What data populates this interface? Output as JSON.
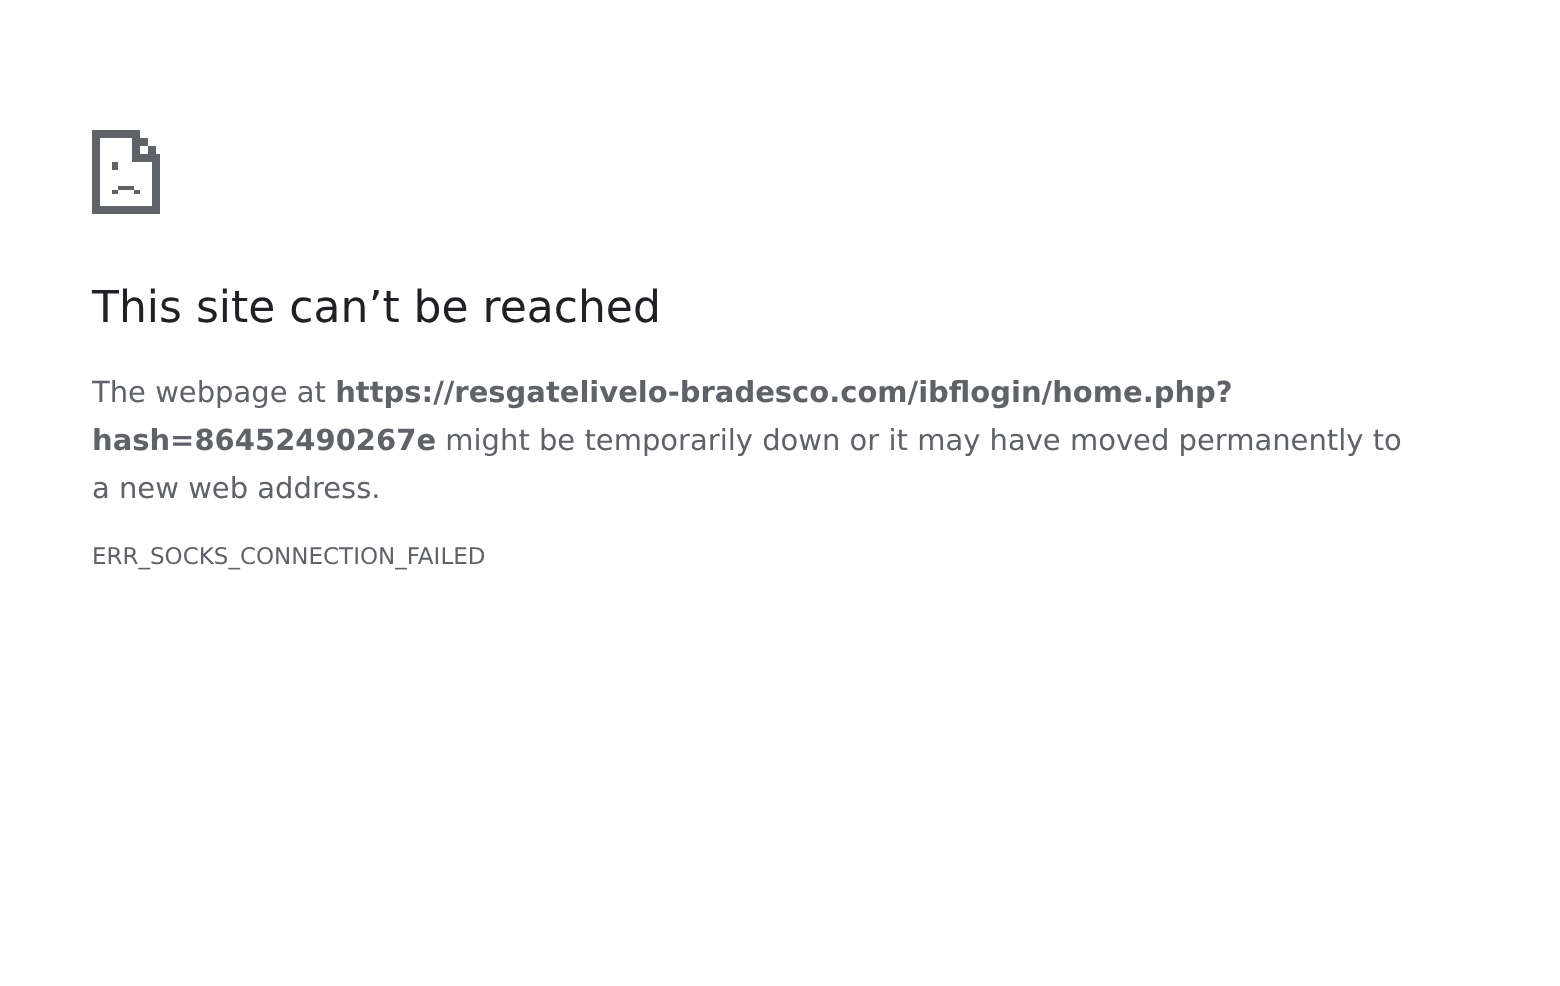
{
  "heading": "This site can’t be reached",
  "description": "The webpage at **https://resgatelivelo-bradesco.com/ibflogin/home.php?hash=86452490267e** might be temporarily down or it may have moved permanently to a new web address.",
  "error_code": "ERR_SOCKS_CONNECTION_FAILED"
}
